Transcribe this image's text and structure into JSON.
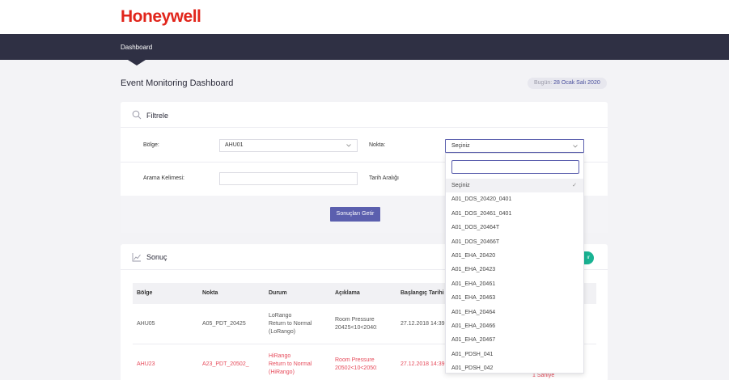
{
  "brand": {
    "logo_text": "Honeywell"
  },
  "nav": {
    "items": [
      "Dashboard"
    ]
  },
  "header": {
    "title": "Event Monitoring Dashboard",
    "date_label": "Bugün:",
    "date_value": "28 Ocak Salı 2020"
  },
  "filter": {
    "title": "Filtrele",
    "bolge_label": "Bölge:",
    "bolge_value": "AHU01",
    "nokta_label": "Nokta:",
    "nokta_value": "Seçiniz",
    "arama_label": "Arama Kelimesi:",
    "tarih_label": "Tarih Aralığı",
    "submit_label": "Sonuçları Getir"
  },
  "result": {
    "title": "Sonuç",
    "button_partial": "ır",
    "columns": [
      "Bölge",
      "Nokta",
      "Durum",
      "Açıklama",
      "Başlangıç Tarihi"
    ],
    "rows": [
      {
        "bolge": "AHU05",
        "nokta": "A05_PDT_20425",
        "durum": [
          "LoRango",
          "Return to Normal",
          "(LoRango)"
        ],
        "aciklama": [
          "Room Pressure",
          "20425<10<20401"
        ],
        "baslangic": "27.12.2018 14:39:53",
        "alert": false
      },
      {
        "bolge": "AHU23",
        "nokta": "A23_PDT_20502_",
        "durum": [
          "HiRango",
          "Return to Normal",
          "(HiRango)"
        ],
        "aciklama": [
          "Room Pressure",
          "20502<10<20501"
        ],
        "baslangic": "27.12.2018 14:39:53",
        "extra": "1 Saniye",
        "alert": true
      }
    ]
  },
  "dropdown": {
    "selected": "Seçiniz",
    "options": [
      "Seçiniz",
      "A01_DOS_20420_0401",
      "A01_DOS_20461_0401",
      "A01_DOS_20464T",
      "A01_DOS_20466T",
      "A01_EHA_20420",
      "A01_EHA_20423",
      "A01_EHA_20461",
      "A01_EHA_20463",
      "A01_EHA_20464",
      "A01_EHA_20466",
      "A01_EHA_20467",
      "A01_PDSH_041",
      "A01_PDSH_042"
    ]
  },
  "colors": {
    "brand_red": "#e1251b",
    "navbar": "#2f3044",
    "primary": "#5b5fae",
    "success": "#19b393",
    "alert_text": "#e64a5a"
  }
}
